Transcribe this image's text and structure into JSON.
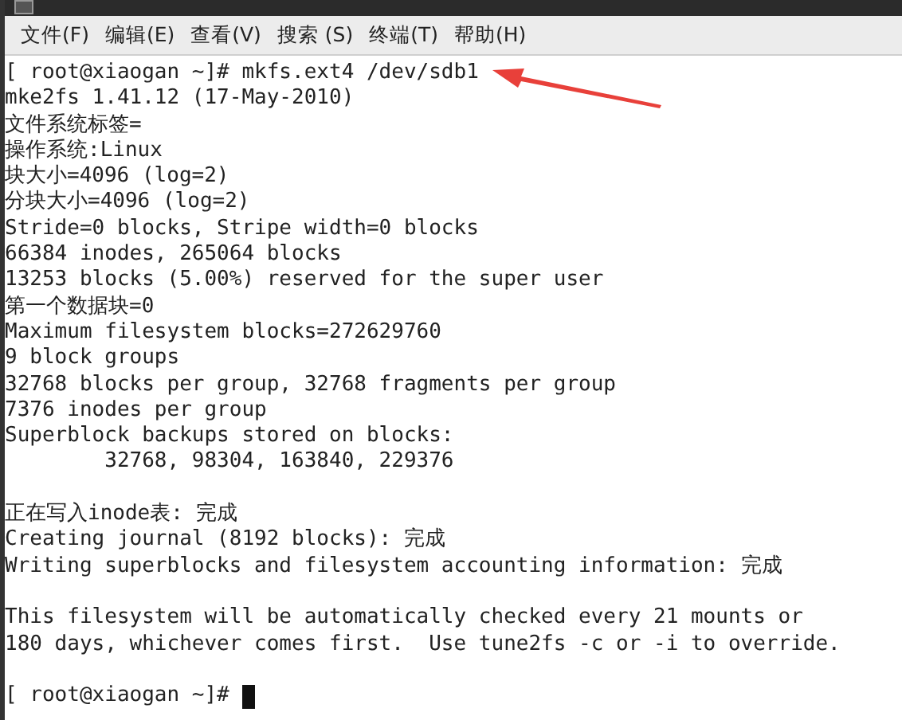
{
  "menu": [
    {
      "label": "文件(F)"
    },
    {
      "label": "编辑(E)"
    },
    {
      "label": "查看(V)"
    },
    {
      "label": "搜索 (S)"
    },
    {
      "label": "终端(T)"
    },
    {
      "label": "帮助(H)"
    }
  ],
  "terminal": {
    "blocks": [
      [
        "[ root@xiaogan ~]# mkfs.ext4 /dev/sdb1",
        "mke2fs 1.41.12 (17-May-2010)",
        "文件系统标签=",
        "操作系统:Linux",
        "块大小=4096 (log=2)",
        "分块大小=4096 (log=2)",
        "Stride=0 blocks, Stripe width=0 blocks",
        "66384 inodes, 265064 blocks",
        "13253 blocks (5.00%) reserved for the super user",
        "第一个数据块=0",
        "Maximum filesystem blocks=272629760",
        "9 block groups",
        "32768 blocks per group, 32768 fragments per group",
        "7376 inodes per group",
        "Superblock backups stored on blocks:",
        "        32768, 98304, 163840, 229376"
      ],
      [
        "正在写入inode表: 完成",
        "Creating journal (8192 blocks): 完成",
        "Writing superblocks and filesystem accounting information: 完成"
      ],
      [
        "This filesystem will be automatically checked every 21 mounts or",
        "180 days, whichever comes first.  Use tune2fs -c or -i to override."
      ]
    ],
    "prompt": "[ root@xiaogan ~]# "
  }
}
